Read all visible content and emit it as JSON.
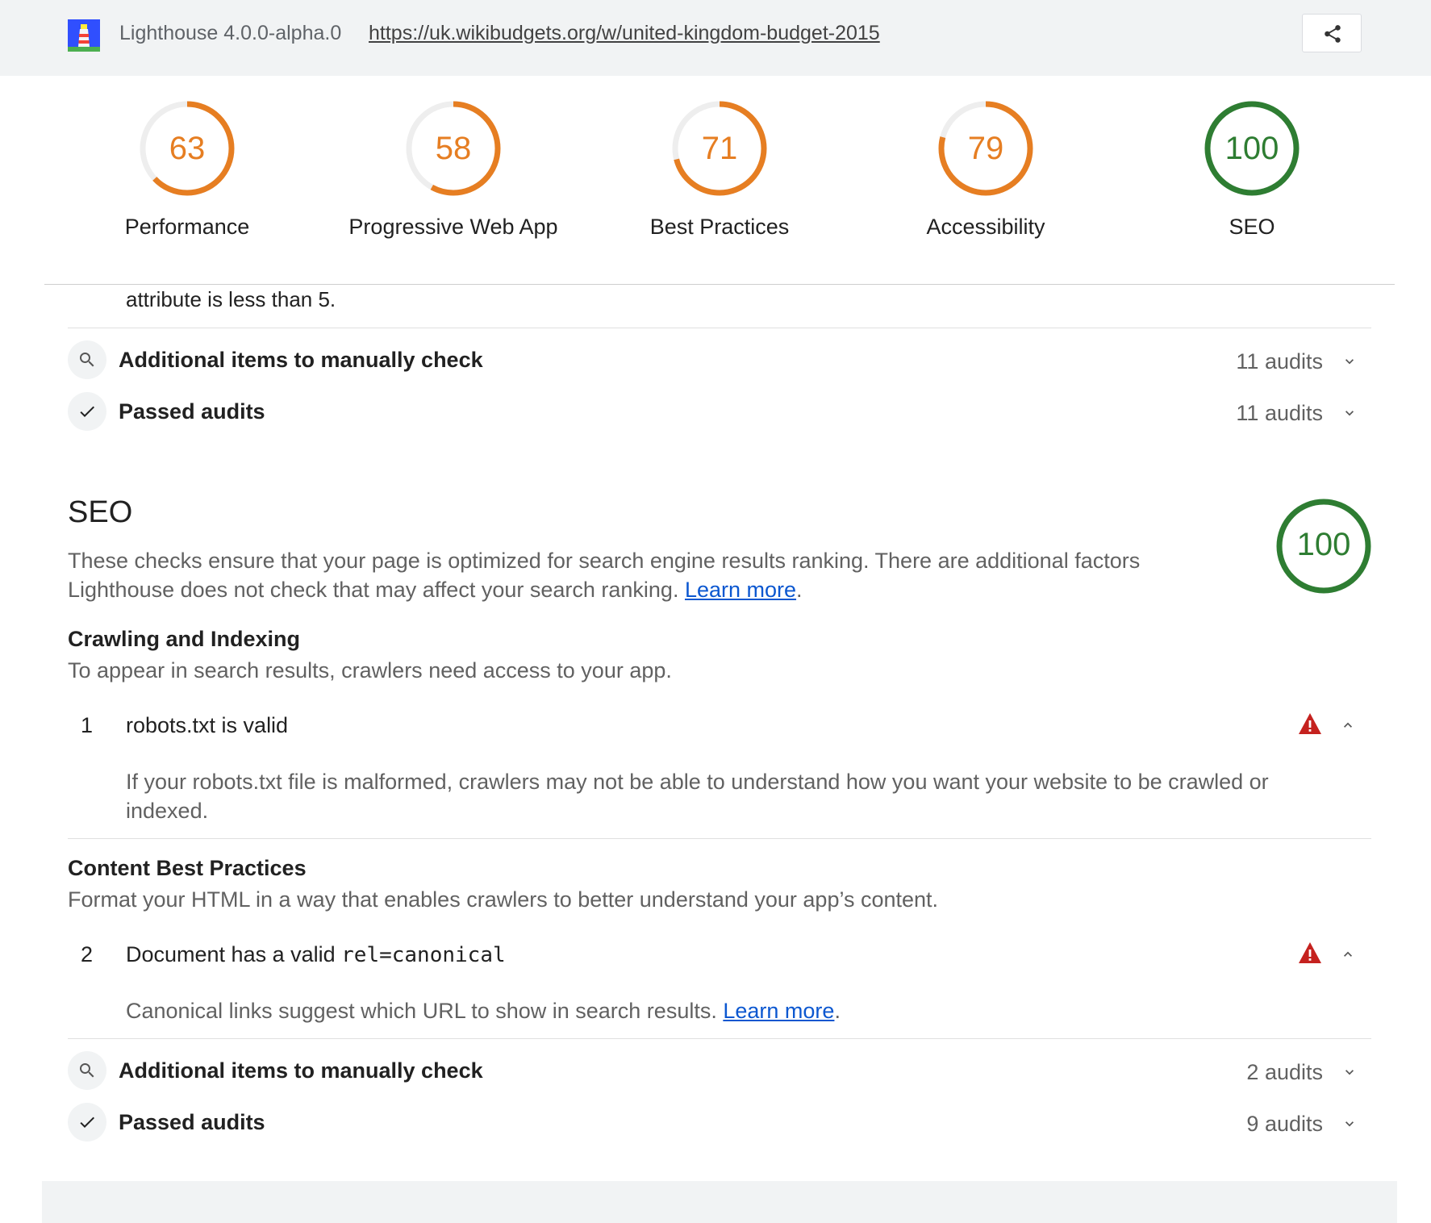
{
  "header": {
    "version": "Lighthouse 4.0.0-alpha.0",
    "url": "https://uk.wikibudgets.org/w/united-kingdom-budget-2015",
    "share_icon": "share-icon"
  },
  "gauges": [
    {
      "label": "Performance",
      "score": "63",
      "fraction": 0.63,
      "color": "#e67e22"
    },
    {
      "label": "Progressive Web App",
      "score": "58",
      "fraction": 0.58,
      "color": "#e67e22"
    },
    {
      "label": "Best Practices",
      "score": "71",
      "fraction": 0.71,
      "color": "#e67e22"
    },
    {
      "label": "Accessibility",
      "score": "79",
      "fraction": 0.79,
      "color": "#e67e22"
    },
    {
      "label": "SEO",
      "score": "100",
      "fraction": 1.0,
      "color": "#2e7d32"
    }
  ],
  "accessibility_tail": {
    "cut_text": "attribute is less than 5.",
    "manual": {
      "title": "Additional items to manually check",
      "count": "11 audits",
      "icon": "search-icon"
    },
    "passed": {
      "title": "Passed audits",
      "count": "11 audits",
      "icon": "check-icon"
    }
  },
  "seo": {
    "title": "SEO",
    "description": "These checks ensure that your page is optimized for search engine results ranking. There are additional factors Lighthouse does not check that may affect your search ranking.",
    "learn_more": "Learn more",
    "score": "100",
    "crawling": {
      "title": "Crawling and Indexing",
      "description": "To appear in search results, crawlers need access to your app."
    },
    "audit1": {
      "index": "1",
      "title": "robots.txt is valid",
      "description": "If your robots.txt file is malformed, crawlers may not be able to understand how you want your website to be crawled or indexed."
    },
    "content": {
      "title": "Content Best Practices",
      "description": "Format your HTML in a way that enables crawlers to better understand your app’s content."
    },
    "audit2": {
      "index": "2",
      "title_prefix": "Document has a valid ",
      "title_code": "rel=canonical",
      "description": "Canonical links suggest which URL to show in search results.",
      "learn_more": "Learn more"
    },
    "manual": {
      "title": "Additional items to manually check",
      "count": "2 audits",
      "icon": "search-icon"
    },
    "passed": {
      "title": "Passed audits",
      "count": "9 audits",
      "icon": "check-icon"
    }
  },
  "colors": {
    "fail": "#c5221f",
    "average": "#e67e22",
    "pass": "#2e7d32",
    "link": "#0b57d0"
  }
}
